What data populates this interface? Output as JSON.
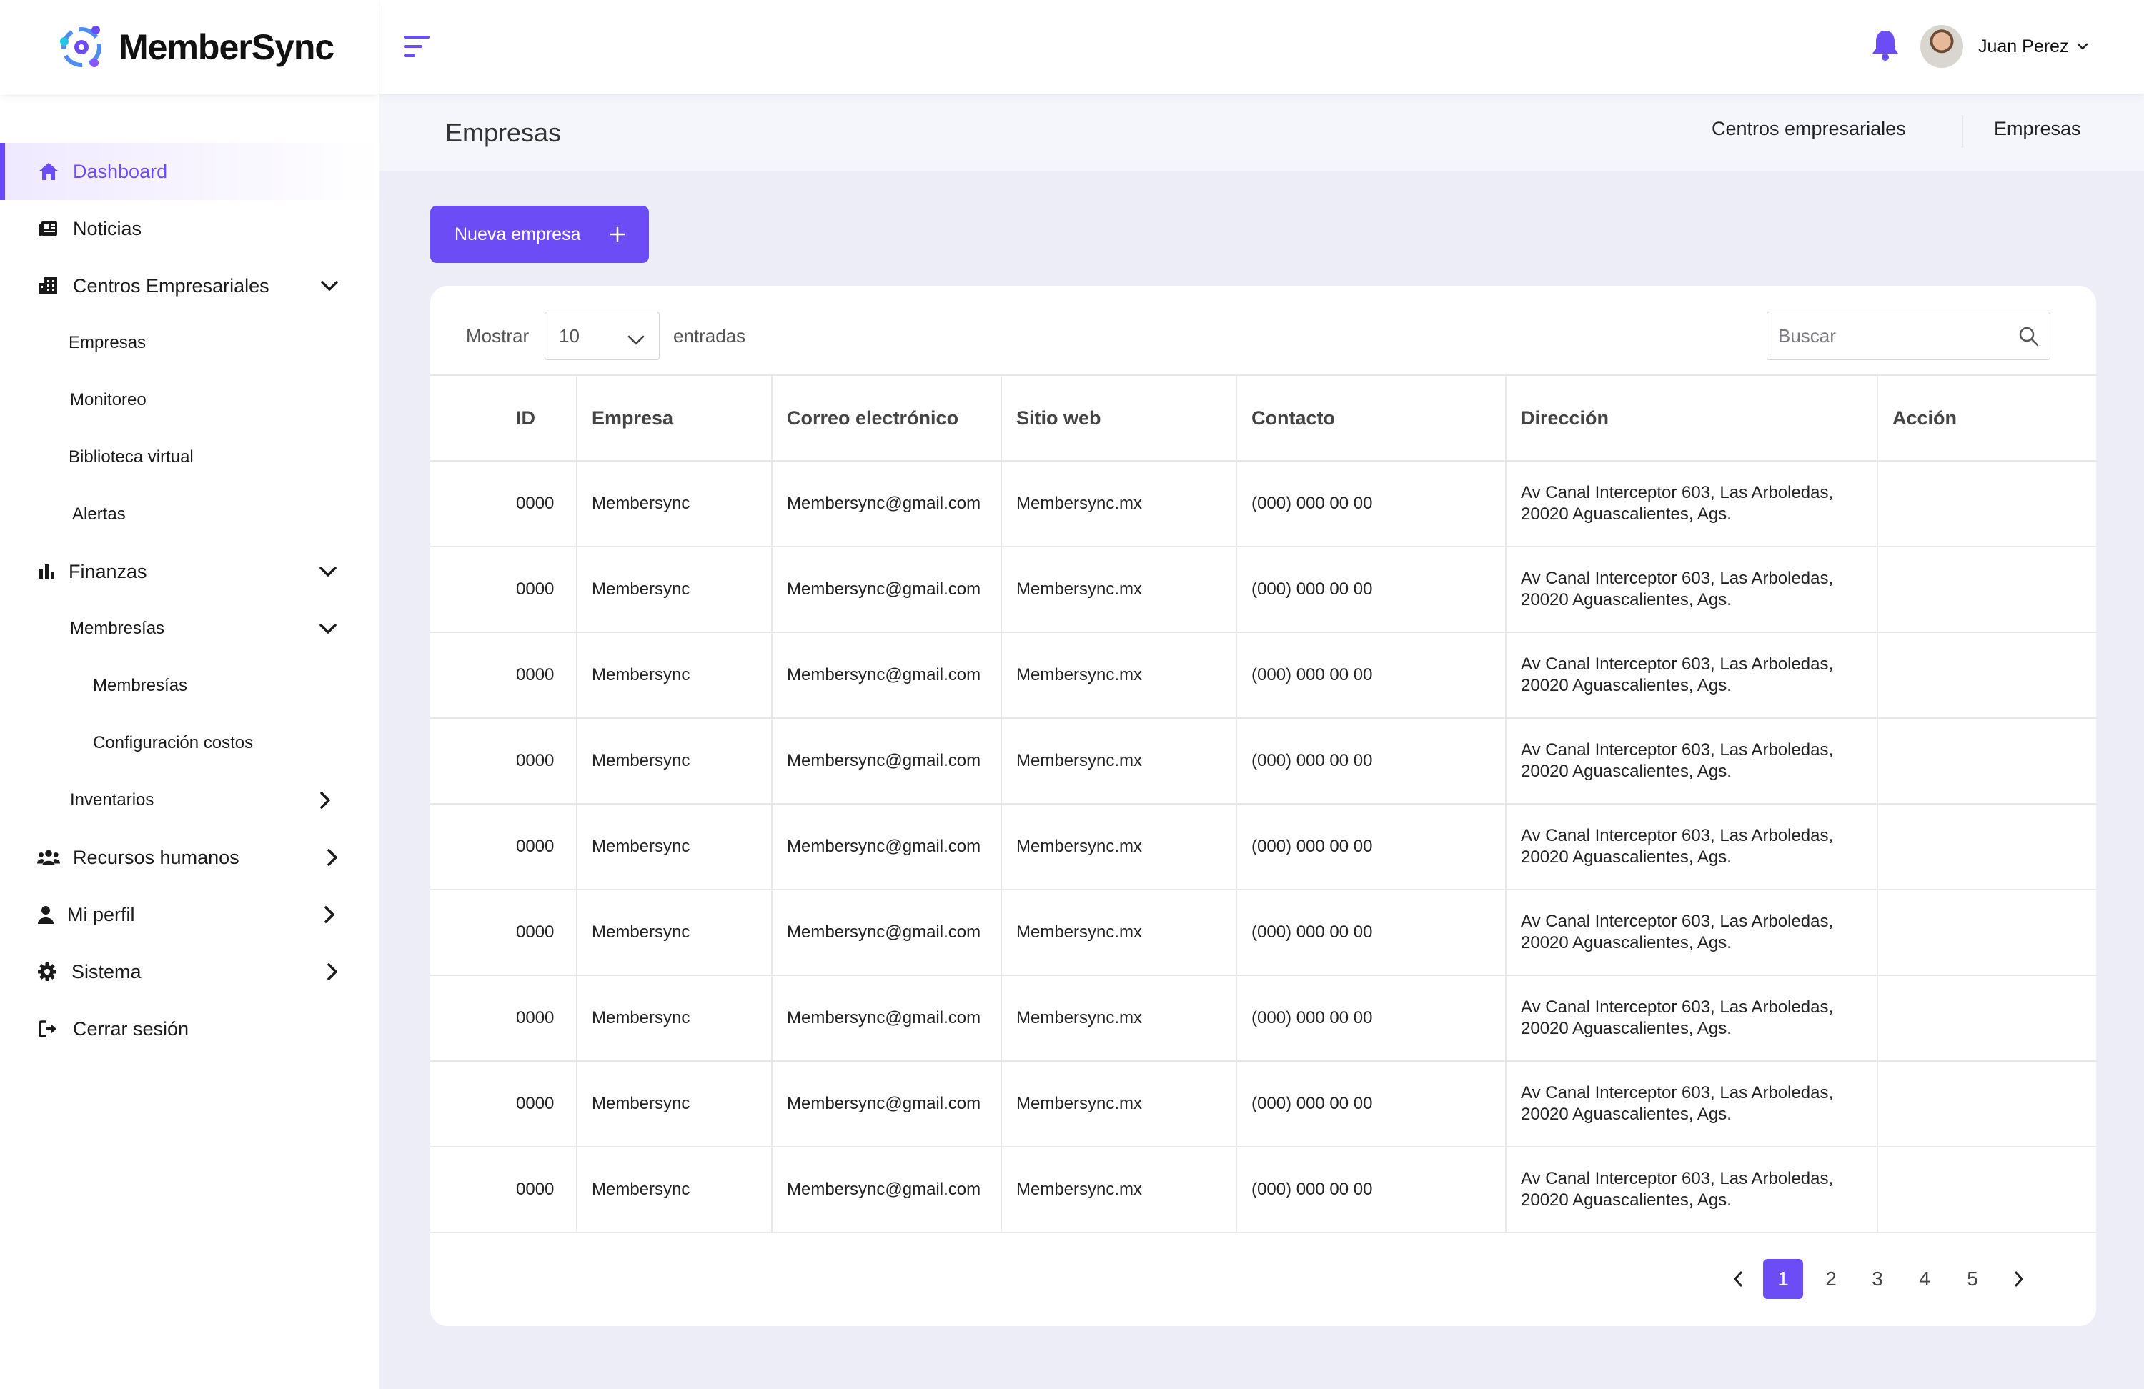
{
  "app": {
    "name": "MemberSync"
  },
  "sidebar": {
    "items": [
      {
        "label": "Dashboard",
        "icon": "home-icon"
      },
      {
        "label": "Noticias",
        "icon": "newspaper-icon"
      },
      {
        "label": "Centros Empresariales",
        "icon": "building-icon"
      },
      {
        "label": "Empresas"
      },
      {
        "label": "Monitoreo"
      },
      {
        "label": "Biblioteca virtual"
      },
      {
        "label": "Alertas"
      },
      {
        "label": "Finanzas",
        "icon": "bar-chart-icon"
      },
      {
        "label": "Membresías"
      },
      {
        "label": "Membresías"
      },
      {
        "label": "Configuración costos"
      },
      {
        "label": "Inventarios"
      },
      {
        "label": "Recursos humanos",
        "icon": "users-icon"
      },
      {
        "label": "Mi perfil",
        "icon": "user-icon"
      },
      {
        "label": "Sistema",
        "icon": "gear-icon"
      },
      {
        "label": "Cerrar sesión",
        "icon": "logout-icon"
      }
    ]
  },
  "topbar": {
    "user_name": "Juan Perez"
  },
  "page": {
    "title": "Empresas",
    "breadcrumb": [
      "Centros empresariales",
      "Empresas"
    ],
    "new_button_label": "Nueva empresa"
  },
  "table_controls": {
    "show_label": "Mostrar",
    "page_size": "10",
    "entries_label": "entradas",
    "search_placeholder": "Buscar"
  },
  "table": {
    "headers": [
      "ID",
      "Empresa",
      "Correo electrónico",
      "Sitio web",
      "Contacto",
      "Dirección",
      "Acción"
    ],
    "rows": [
      [
        "0000",
        "Membersync",
        "Membersync@gmail.com",
        "Membersync.mx",
        "(000) 000 00 00",
        "Av Canal Interceptor 603, Las Arboledas, 20020 Aguascalientes, Ags.",
        ""
      ],
      [
        "0000",
        "Membersync",
        "Membersync@gmail.com",
        "Membersync.mx",
        "(000) 000 00 00",
        "Av Canal Interceptor 603, Las Arboledas, 20020 Aguascalientes, Ags.",
        ""
      ],
      [
        "0000",
        "Membersync",
        "Membersync@gmail.com",
        "Membersync.mx",
        "(000) 000 00 00",
        "Av Canal Interceptor 603, Las Arboledas, 20020 Aguascalientes, Ags.",
        ""
      ],
      [
        "0000",
        "Membersync",
        "Membersync@gmail.com",
        "Membersync.mx",
        "(000) 000 00 00",
        "Av Canal Interceptor 603, Las Arboledas, 20020 Aguascalientes, Ags.",
        ""
      ],
      [
        "0000",
        "Membersync",
        "Membersync@gmail.com",
        "Membersync.mx",
        "(000) 000 00 00",
        "Av Canal Interceptor 603, Las Arboledas, 20020 Aguascalientes, Ags.",
        ""
      ],
      [
        "0000",
        "Membersync",
        "Membersync@gmail.com",
        "Membersync.mx",
        "(000) 000 00 00",
        "Av Canal Interceptor 603, Las Arboledas, 20020 Aguascalientes, Ags.",
        ""
      ],
      [
        "0000",
        "Membersync",
        "Membersync@gmail.com",
        "Membersync.mx",
        "(000) 000 00 00",
        "Av Canal Interceptor 603, Las Arboledas, 20020 Aguascalientes, Ags.",
        ""
      ],
      [
        "0000",
        "Membersync",
        "Membersync@gmail.com",
        "Membersync.mx",
        "(000) 000 00 00",
        "Av Canal Interceptor 603, Las Arboledas, 20020 Aguascalientes, Ags.",
        ""
      ],
      [
        "0000",
        "Membersync",
        "Membersync@gmail.com",
        "Membersync.mx",
        "(000) 000 00 00",
        "Av Canal Interceptor 603, Las Arboledas, 20020 Aguascalientes, Ags.",
        ""
      ]
    ]
  },
  "pagination": {
    "pages": [
      "1",
      "2",
      "3",
      "4",
      "5"
    ],
    "current": "1"
  },
  "colors": {
    "accent": "#6c4cf5",
    "background": "#ecedf7"
  }
}
